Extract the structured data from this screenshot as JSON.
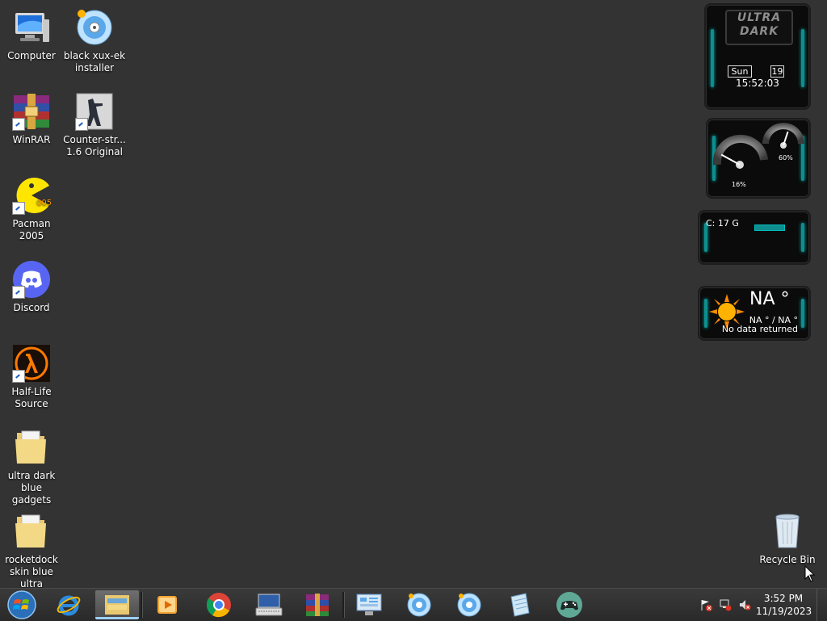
{
  "desktop": {
    "icons": [
      {
        "label": "Computer",
        "icon": "computer-icon"
      },
      {
        "label": "black xux-ek installer",
        "icon": "disc-icon"
      },
      {
        "label": "WinRAR",
        "icon": "winrar-icon"
      },
      {
        "label": "Counter-str...\n1.6 Original",
        "icon": "counter-strike-icon"
      },
      {
        "label": "Pacman 2005",
        "icon": "pacman-icon"
      },
      {
        "label": "Discord",
        "icon": "discord-icon"
      },
      {
        "label": "Half-Life Source",
        "icon": "half-life-icon"
      },
      {
        "label": "ultra dark blue gadgets",
        "icon": "folder-icon"
      },
      {
        "label": "rocketdock skin blue ultra",
        "icon": "folder-icon"
      },
      {
        "label": "Recycle Bin",
        "icon": "recycle-bin-icon"
      }
    ]
  },
  "gadgets": {
    "clock": {
      "logo_line1": "ULTRA",
      "logo_line2": "DARK",
      "day": "Sun",
      "date": "19",
      "time": "15:52:03"
    },
    "meters": {
      "cpu_label": "16%",
      "ram_label": "60%",
      "cpu_level": 16,
      "ram_level": 60
    },
    "drive": {
      "label": "C: 17 G"
    },
    "weather": {
      "temp": "NA °",
      "range": "NA ° / NA °",
      "status": "No data returned"
    }
  },
  "taskbar": {
    "start": "windows-start-icon",
    "pinned": [
      "internet-explorer-icon",
      "file-explorer-icon",
      "media-player-icon",
      "chrome-icon",
      "keyboard-icon",
      "winrar-icon",
      "control-panel-icon",
      "disc-icon",
      "disc-icon",
      "notepad-icon",
      "gamepad-icon"
    ],
    "tray": [
      "action-center-flag-icon",
      "network-icon",
      "volume-muted-icon"
    ],
    "clock_time": "3:52 PM",
    "clock_date": "11/19/2023"
  },
  "colors": {
    "desktop_bg": "#333333",
    "accent": "#0e8e8e"
  }
}
